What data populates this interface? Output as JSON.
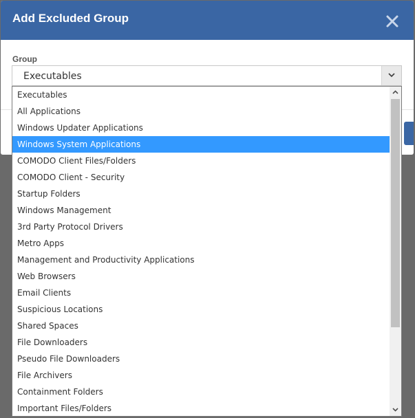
{
  "dialog": {
    "title": "Add Excluded Group",
    "close_icon": "close-icon",
    "group_label": "Group"
  },
  "select": {
    "value": "Executables",
    "caret_icon": "chevron-down-icon"
  },
  "dropdown": {
    "selected_index": 3,
    "options": [
      "Executables",
      "All Applications",
      "Windows Updater Applications",
      "Windows System Applications",
      "COMODO Client Files/Folders",
      "COMODO Client - Security",
      "Startup Folders",
      "Windows Management",
      "3rd Party Protocol Drivers",
      "Metro Apps",
      "Management and Productivity Applications",
      "Web Browsers",
      "Email Clients",
      "Suspicious Locations",
      "Shared Spaces",
      "File Downloaders",
      "Pseudo File Downloaders",
      "File Archivers",
      "Containment Folders",
      "Important Files/Folders"
    ]
  },
  "colors": {
    "header": "#3a66a4",
    "highlight": "#3399ff",
    "overlay": "#6a6a6a"
  }
}
